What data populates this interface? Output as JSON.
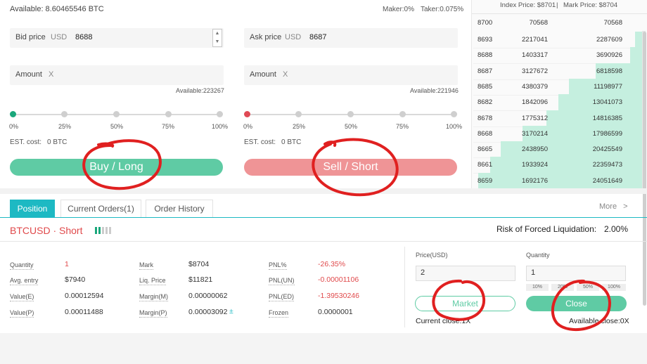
{
  "header": {
    "available": "Available: 8.60465546 BTC",
    "maker": "Maker:0%",
    "taker": "Taker:0.075%"
  },
  "buy": {
    "price_label": "Bid price",
    "price_unit": "USD",
    "price_value": "8688",
    "amount_label": "Amount",
    "amount_unit": "X",
    "available": "Available:223267",
    "est_label": "EST. cost:",
    "est_value": "0 BTC",
    "button": "Buy / Long",
    "slider_value_pct": 0
  },
  "sell": {
    "price_label": "Ask price",
    "price_unit": "USD",
    "price_value": "8687",
    "amount_label": "Amount",
    "amount_unit": "X",
    "available": "Available:221946",
    "est_label": "EST. cost:",
    "est_value": "0 BTC",
    "button": "Sell / Short",
    "slider_value_pct": 0
  },
  "slider_ticks": [
    "0%",
    "25%",
    "50%",
    "75%",
    "100%"
  ],
  "colors": {
    "buy": "#5fcba4",
    "sell": "#ef9496",
    "accent": "#1db9c3",
    "annotation": "#e02020"
  },
  "orderbook": {
    "index_price": "Index Price: $8701",
    "separator": "|",
    "mark_price": "Mark Price: $8704",
    "header": [
      "8700",
      "70568",
      "70568"
    ],
    "rows": [
      {
        "price": "8693",
        "size": "2217041",
        "total": "2287609",
        "depth": 0.05
      },
      {
        "price": "8688",
        "size": "1403317",
        "total": "3690926",
        "depth": 0.08
      },
      {
        "price": "8687",
        "size": "3127672",
        "total": "6818598",
        "depth": 0.28
      },
      {
        "price": "8685",
        "size": "4380379",
        "total": "11198977",
        "depth": 0.44
      },
      {
        "price": "8682",
        "size": "1842096",
        "total": "13041073",
        "depth": 0.5
      },
      {
        "price": "8678",
        "size": "1775312",
        "total": "14816385",
        "depth": 0.57
      },
      {
        "price": "8668",
        "size": "3170214",
        "total": "17986599",
        "depth": 0.71
      },
      {
        "price": "8665",
        "size": "2438950",
        "total": "20425549",
        "depth": 0.84
      },
      {
        "price": "8661",
        "size": "1933924",
        "total": "22359473",
        "depth": 0.9
      },
      {
        "price": "8659",
        "size": "1692176",
        "total": "24051649",
        "depth": 0.97
      }
    ]
  },
  "tabs": [
    {
      "label": "Position",
      "active": true
    },
    {
      "label": "Current Orders(1)",
      "active": false
    },
    {
      "label": "Order History",
      "active": false
    }
  ],
  "more": "More",
  "more_chevron": ">",
  "position": {
    "symbol": "BTCUSD · Short",
    "risk_label": "Risk of Forced Liquidation:",
    "risk_value": "2.00%",
    "fields": {
      "quantity_label": "Quantity",
      "quantity": "1",
      "avg_entry_label": "Avg. entry",
      "avg_entry": "$7940",
      "value_e_label": "Value(E)",
      "value_e": "0.00012594",
      "value_p_label": "Value(P)",
      "value_p": "0.00011488",
      "mark_label": "Mark",
      "mark": "$8704",
      "liq_label": "Liq. Price",
      "liq": "$11821",
      "margin_m_label": "Margin(M)",
      "margin_m": "0.00000062",
      "margin_p_label": "Margin(P)",
      "margin_p": "0.00003092",
      "margin_plus": "±",
      "pnl_pct_label": "PNL%",
      "pnl_pct": "-26.35%",
      "pnl_un_label": "PNL(UN)",
      "pnl_un": "-0.00001106",
      "pnl_ed_label": "PNL(ED)",
      "pnl_ed": "-1.39530246",
      "frozen_label": "Frozen",
      "frozen": "0.0000001"
    }
  },
  "close_panel": {
    "price_label": "Price(USD)",
    "price_value": "2",
    "qty_label": "Quantity",
    "qty_value": "1",
    "qty_pcts": [
      "10%",
      "20%",
      "50%",
      "100%"
    ],
    "market_button": "Market",
    "close_button": "Close",
    "current_close": "Current close:1X",
    "available_close": "Available close:0X"
  }
}
